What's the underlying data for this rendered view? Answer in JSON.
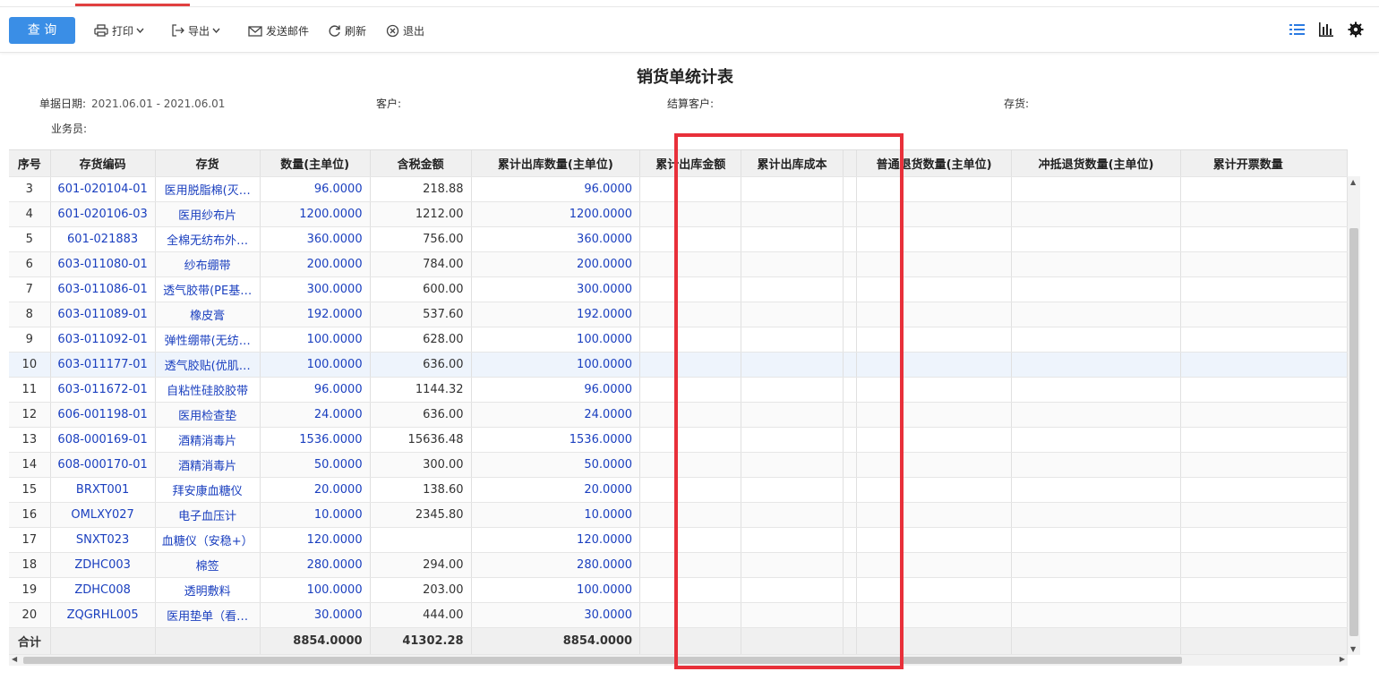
{
  "toolbar": {
    "query_label": "查 询",
    "print_label": "打印",
    "export_label": "导出",
    "email_label": "发送邮件",
    "refresh_label": "刷新",
    "exit_label": "退出"
  },
  "report": {
    "title": "销货单统计表",
    "filters": {
      "date_label": "单据日期:",
      "date_value": "2021.06.01 - 2021.06.01",
      "customer_label": "客户:",
      "settle_customer_label": "结算客户:",
      "stock_label": "存货:",
      "salesman_label": "业务员:"
    }
  },
  "table": {
    "headers": [
      "序号",
      "存货编码",
      "存货",
      "数量(主单位)",
      "含税金额",
      "累计出库数量(主单位)",
      "累计出库金额",
      "累计出库成本",
      "",
      "普通退货数量(主单位)",
      "冲抵退货数量(主单位)",
      "累计开票数量"
    ],
    "rows": [
      [
        "3",
        "601-020104-01",
        "医用脱脂棉(灭…",
        "96.0000",
        "218.88",
        "96.0000"
      ],
      [
        "4",
        "601-020106-03",
        "医用纱布片",
        "1200.0000",
        "1212.00",
        "1200.0000"
      ],
      [
        "5",
        "601-021883",
        "全棉无纺布外…",
        "360.0000",
        "756.00",
        "360.0000"
      ],
      [
        "6",
        "603-011080-01",
        "纱布绷带",
        "200.0000",
        "784.00",
        "200.0000"
      ],
      [
        "7",
        "603-011086-01",
        "透气胶带(PE基…",
        "300.0000",
        "600.00",
        "300.0000"
      ],
      [
        "8",
        "603-011089-01",
        "橡皮膏",
        "192.0000",
        "537.60",
        "192.0000"
      ],
      [
        "9",
        "603-011092-01",
        "弹性绷带(无纺…",
        "100.0000",
        "628.00",
        "100.0000"
      ],
      [
        "10",
        "603-011177-01",
        "透气胶贴(优肌…",
        "100.0000",
        "636.00",
        "100.0000"
      ],
      [
        "11",
        "603-011672-01",
        "自粘性硅胶胶带",
        "96.0000",
        "1144.32",
        "96.0000"
      ],
      [
        "12",
        "606-001198-01",
        "医用检查垫",
        "24.0000",
        "636.00",
        "24.0000"
      ],
      [
        "13",
        "608-000169-01",
        "酒精消毒片",
        "1536.0000",
        "15636.48",
        "1536.0000"
      ],
      [
        "14",
        "608-000170-01",
        "酒精消毒片",
        "50.0000",
        "300.00",
        "50.0000"
      ],
      [
        "15",
        "BRXT001",
        "拜安康血糖仪",
        "20.0000",
        "138.60",
        "20.0000"
      ],
      [
        "16",
        "OMLXY027",
        "电子血压计",
        "10.0000",
        "2345.80",
        "10.0000"
      ],
      [
        "17",
        "SNXT023",
        "血糖仪（安稳+）",
        "120.0000",
        "",
        "120.0000"
      ],
      [
        "18",
        "ZDHC003",
        "棉签",
        "280.0000",
        "294.00",
        "280.0000"
      ],
      [
        "19",
        "ZDHC008",
        "透明敷料",
        "100.0000",
        "203.00",
        "100.0000"
      ],
      [
        "20",
        "ZQGRHL005",
        "医用垫单（看…",
        "30.0000",
        "444.00",
        "30.0000"
      ]
    ],
    "total": {
      "label": "合计",
      "quantity": "8854.0000",
      "amount": "41302.28",
      "out_quantity": "8854.0000"
    },
    "highlighted_row": "10"
  },
  "colors": {
    "primary": "#3a8ee6",
    "link": "#1a3fbf",
    "annotation": "#e8303a",
    "active_tab": "#e04040"
  }
}
